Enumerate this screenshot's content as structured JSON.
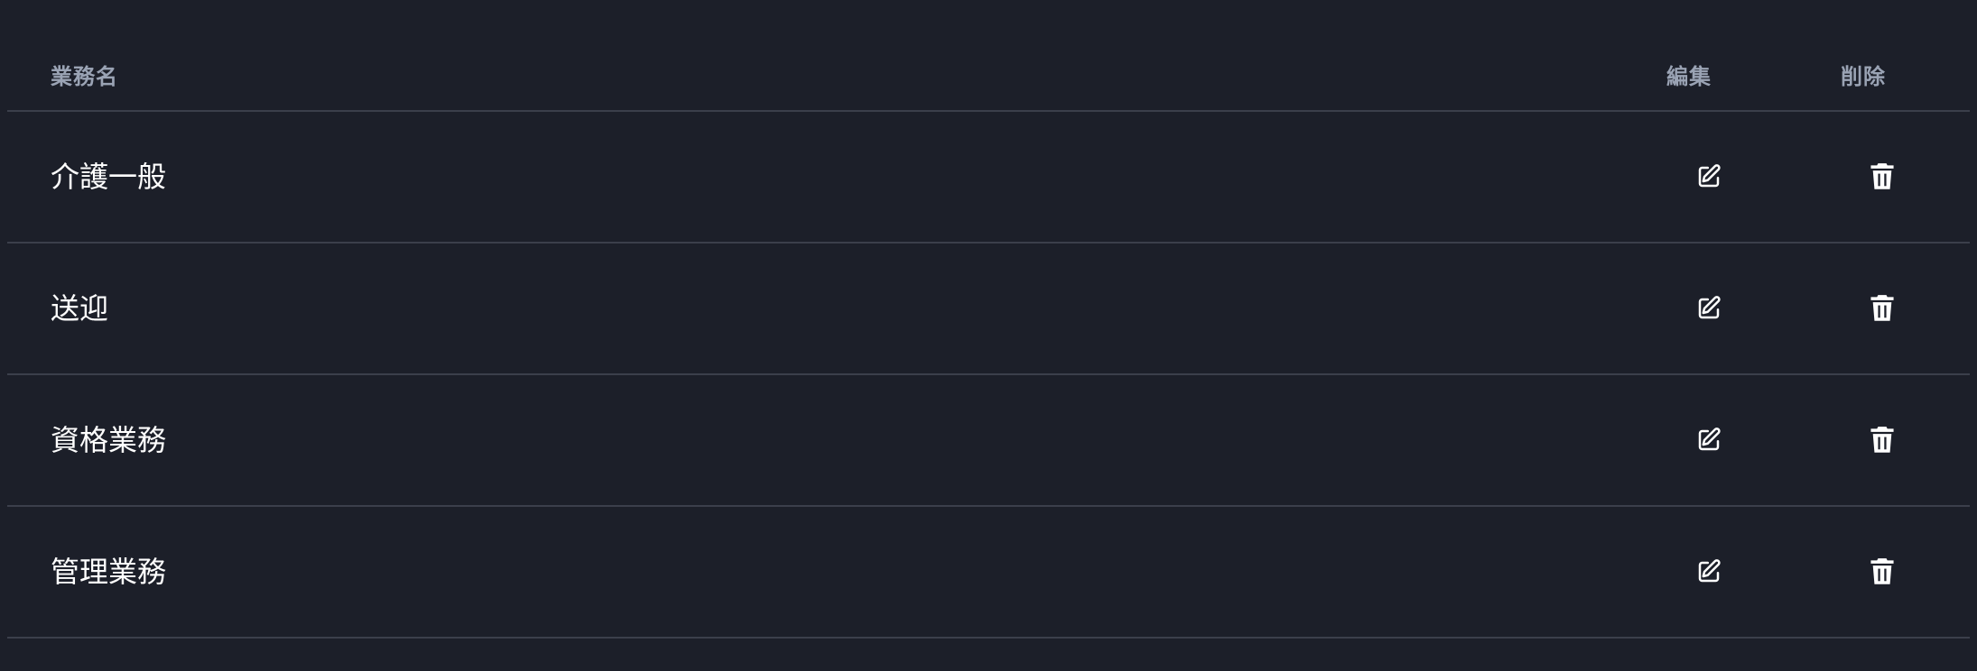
{
  "table": {
    "headers": {
      "name": "業務名",
      "edit": "編集",
      "delete": "削除"
    },
    "rows": [
      {
        "name": "介護一般",
        "edit_icon": "edit-icon",
        "delete_icon": "trash-icon"
      },
      {
        "name": "送迎",
        "edit_icon": "edit-icon",
        "delete_icon": "trash-icon"
      },
      {
        "name": "資格業務",
        "edit_icon": "edit-icon",
        "delete_icon": "trash-icon"
      },
      {
        "name": "管理業務",
        "edit_icon": "edit-icon",
        "delete_icon": "trash-icon"
      }
    ]
  },
  "colors": {
    "background": "#1c1f29",
    "header_text": "#9aa3b4",
    "row_text": "#ffffff",
    "divider": "#3b3f4b"
  }
}
